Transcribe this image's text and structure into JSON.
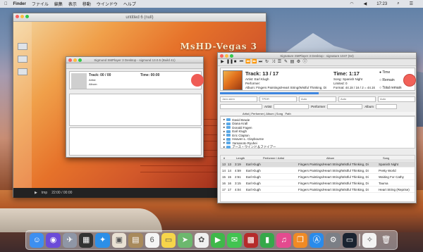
{
  "menubar": {
    "app": "Finder",
    "items": [
      "ファイル",
      "編集",
      "表示",
      "移動",
      "ウインドウ",
      "ヘルプ"
    ],
    "clock": "17:23"
  },
  "vegas": {
    "title": "untitled 6 (null)",
    "brand": "MsHD-Vegas 3",
    "status_left": "tmp",
    "status_right": "22:00 / 00:00"
  },
  "small_player": {
    "title": "Sigmund SMPlayer 3 Desktop - sigmund 13.0.5 (Build 41)",
    "track": "Track: 00 / 00",
    "time": "Time: 00:00",
    "artist": "Artist:",
    "album": "Album:"
  },
  "player": {
    "title": "Signature SMPlayer 3 Desktop - signature 1047 (64)",
    "track_label": "Track:",
    "track_value": "13 / 17",
    "artist": "Artist: Earl Klugh",
    "performer": "Performer:",
    "album": "Album: Fingers Paintings/Heart String/Wistful Thinking, Di",
    "time_label": "Time:",
    "time_value": "1:17",
    "song": "Song: Spanish Night",
    "limited": "Limited: 0",
    "format": "Format: 44.1k / 16 / 2 = 44.1k",
    "radio_time": "Time",
    "radio_remain": "Remain",
    "radio_total": "Total remain",
    "filters": [
      "Jaxx-skim",
      "TPDR",
      "Auto",
      "Auto",
      "Auto"
    ],
    "search_labels": {
      "artist": "Artist",
      "performer": "Performer",
      "album": "Album"
    },
    "tree_header": "Artist | Performer | Album | Song",
    "tree_col_path": "Path",
    "tree_items": [
      "David Bowie",
      "Diana Krall",
      "Donald Fagen",
      "Earl Klugh",
      "Eric Clapton",
      "Heaven L. Claybourne",
      "Yamanoto Ryuhei",
      "アース・ウインド＆ファイアー"
    ],
    "columns": [
      "#",
      "Length",
      "Performer / Artist",
      "Album",
      "Song"
    ],
    "rows": [
      {
        "num": "13",
        "trk": "13",
        "len": "3:19",
        "artist": "Earl Klugh",
        "album": "Fingers Paintings/Heart String/Wistful Thinking, Di",
        "song": "Spanish Night"
      },
      {
        "num": "14",
        "trk": "14",
        "len": "4:59",
        "artist": "Earl Klugh",
        "album": "Fingers Paintings/Heart String/Wistful Thinking, Di",
        "song": "Pretty World"
      },
      {
        "num": "15",
        "trk": "15",
        "len": "2:51",
        "artist": "Earl Klugh",
        "album": "Fingers Paintings/Heart String/Wistful Thinking, Di",
        "song": "Waiting For Cathy"
      },
      {
        "num": "16",
        "trk": "16",
        "len": "3:15",
        "artist": "Earl Klugh",
        "album": "Fingers Paintings/Heart String/Wistful Thinking, Di",
        "song": "Tauma"
      },
      {
        "num": "17",
        "trk": "17",
        "len": "4:04",
        "artist": "Earl Klugh",
        "album": "Fingers Paintings/Heart String/Wistful Thinking, Di",
        "song": "Heart String (Reprise)"
      }
    ]
  },
  "dock": {
    "icons": [
      {
        "name": "finder-icon",
        "glyph": "☺",
        "color": "#3d8ff0"
      },
      {
        "name": "siri-icon",
        "glyph": "◉",
        "color": "#6b4bd8"
      },
      {
        "name": "launchpad-icon",
        "glyph": "✈",
        "color": "#8f96a6"
      },
      {
        "name": "mission-control-icon",
        "glyph": "▦",
        "color": "#333"
      },
      {
        "name": "safari-icon",
        "glyph": "✦",
        "color": "#2c8fe8"
      },
      {
        "name": "photos-app-icon",
        "glyph": "▣",
        "color": "#e9e1d3"
      },
      {
        "name": "contacts-icon",
        "glyph": "▤",
        "color": "#a88a5c"
      },
      {
        "name": "calendar-icon",
        "glyph": "6",
        "color": "#f5f5f5"
      },
      {
        "name": "notes-icon",
        "glyph": "▭",
        "color": "#f7d54a"
      },
      {
        "name": "maps-icon",
        "glyph": "➤",
        "color": "#6cb86e"
      },
      {
        "name": "photos-icon",
        "glyph": "✿",
        "color": "#f0f0f0"
      },
      {
        "name": "facetime-icon",
        "glyph": "▶",
        "color": "#3fb84a"
      },
      {
        "name": "messages-icon",
        "glyph": "✉",
        "color": "#42c451"
      },
      {
        "name": "photo-booth-icon",
        "glyph": "▩",
        "color": "#b52b2b"
      },
      {
        "name": "numbers-icon",
        "glyph": "▮",
        "color": "#36a84a"
      },
      {
        "name": "itunes-icon",
        "glyph": "♫",
        "color": "#e44a8f"
      },
      {
        "name": "ibooks-icon",
        "glyph": "❐",
        "color": "#f08a24"
      },
      {
        "name": "app-store-icon",
        "glyph": "Ⓐ",
        "color": "#2a8bea"
      },
      {
        "name": "system-preferences-icon",
        "glyph": "⚙",
        "color": "#7b7f86"
      },
      {
        "name": "monitor-icon",
        "glyph": "▭",
        "color": "#1a2330"
      },
      {
        "name": "separator-icon",
        "glyph": "",
        "color": "transparent"
      },
      {
        "name": "vegas-app-icon",
        "glyph": "✧",
        "color": "#f3f3f3"
      },
      {
        "name": "trash-icon",
        "glyph": "🗑",
        "color": "transparent"
      }
    ]
  }
}
